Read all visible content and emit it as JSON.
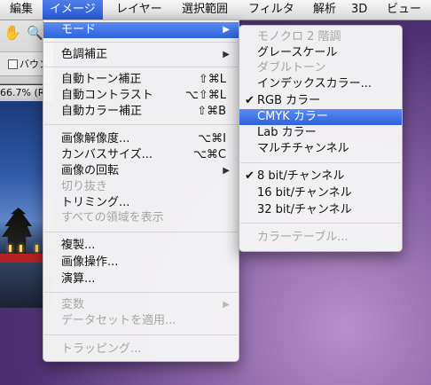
{
  "menubar": {
    "items": [
      "編集",
      "イメージ",
      "レイヤー",
      "選択範囲",
      "フィルタ",
      "解析",
      "3D",
      "ビュー"
    ],
    "active_index": 1
  },
  "options_bar": {
    "checkbox_label": "バウン"
  },
  "document": {
    "tab_title": "66.7% (R"
  },
  "main_menu": {
    "mode": "モード",
    "adjust": "色調補正",
    "auto_tone": "自動トーン補正",
    "auto_tone_shortcut": "⇧⌘L",
    "auto_contrast": "自動コントラスト",
    "auto_contrast_shortcut": "⌥⇧⌘L",
    "auto_color": "自動カラー補正",
    "auto_color_shortcut": "⇧⌘B",
    "image_size": "画像解像度...",
    "image_size_shortcut": "⌥⌘I",
    "canvas_size": "カンバスサイズ...",
    "canvas_size_shortcut": "⌥⌘C",
    "rotation": "画像の回転",
    "crop": "切り抜き",
    "trim": "トリミング...",
    "reveal_all": "すべての領域を表示",
    "duplicate": "複製...",
    "apply_image": "画像操作...",
    "calculations": "演算...",
    "variables": "変数",
    "apply_dataset": "データセットを適用...",
    "trap": "トラッピング..."
  },
  "mode_menu": {
    "bitmap": "モノクロ 2 階調",
    "grayscale": "グレースケール",
    "duotone": "ダブルトーン",
    "indexed": "インデックスカラー...",
    "rgb": "RGB カラー",
    "cmyk": "CMYK カラー",
    "lab": "Lab カラー",
    "multichannel": "マルチチャンネル",
    "bit8": "8 bit/チャンネル",
    "bit16": "16 bit/チャンネル",
    "bit32": "32 bit/チャンネル",
    "color_table": "カラーテーブル...",
    "check": "✔"
  },
  "colors": {
    "highlight": "#2d63dc",
    "disabled_text": "#a6a6a6"
  }
}
